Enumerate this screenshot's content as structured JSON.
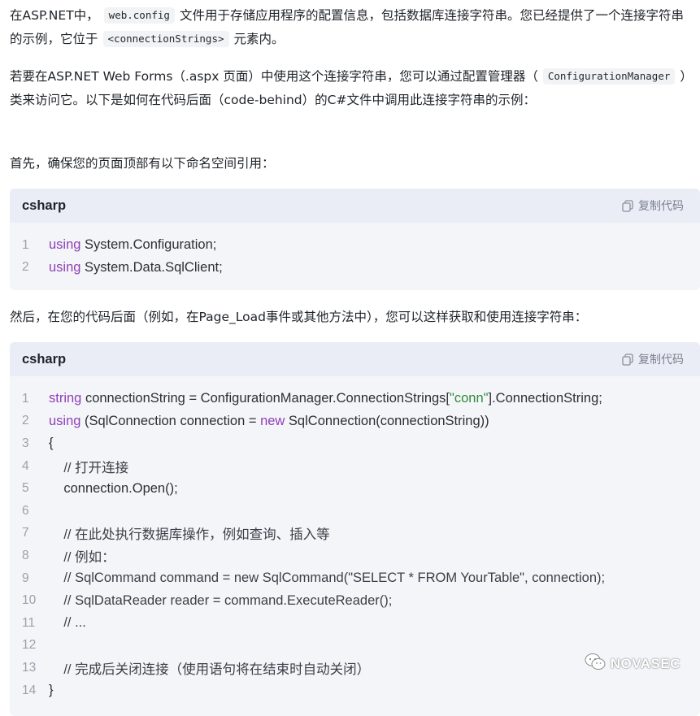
{
  "paragraphs": {
    "p1": {
      "pre": "在ASP.NET中，",
      "code1": "web.config",
      "mid": "文件用于存储应用程序的配置信息，包括数据库连接字符串。您已经提供了一个连接字符串的示例，它位于",
      "code2": "<connectionStrings>",
      "post": "元素内。"
    },
    "p2": {
      "pre": "若要在ASP.NET Web Forms（.aspx 页面）中使用这个连接字符串，您可以通过配置管理器（",
      "code": "ConfigurationManager",
      "post": "）类来访问它。以下是如何在代码后面（code-behind）的C#文件中调用此连接字符串的示例："
    },
    "p3": "首先，确保您的页面顶部有以下命名空间引用：",
    "p4": "然后，在您的代码后面（例如，在Page_Load事件或其他方法中），您可以这样获取和使用连接字符串："
  },
  "code_blocks": [
    {
      "lang": "csharp",
      "copy_label": "复制代码",
      "lines": [
        {
          "n": "1",
          "kw": "using",
          "rest": " System.Configuration;"
        },
        {
          "n": "2",
          "kw": "using",
          "rest": " System.Data.SqlClient;"
        }
      ]
    },
    {
      "lang": "csharp",
      "copy_label": "复制代码",
      "lines": [
        {
          "n": "1",
          "kw": "string",
          "a": " connectionString = ConfigurationManager.ConnectionStrings[",
          "str": "\"conn\"",
          "b": "].ConnectionString;"
        },
        {
          "n": "2",
          "kw": "using",
          "a": " (SqlConnection connection = ",
          "kw2": "new",
          "b": " SqlConnection(connectionString))"
        },
        {
          "n": "3",
          "a": "{"
        },
        {
          "n": "4",
          "a": "    // 打开连接"
        },
        {
          "n": "5",
          "a": "    connection.Open();"
        },
        {
          "n": "6",
          "a": ""
        },
        {
          "n": "7",
          "a": "    // 在此处执行数据库操作，例如查询、插入等"
        },
        {
          "n": "8",
          "a": "    // 例如："
        },
        {
          "n": "9",
          "a": "    // SqlCommand command = new SqlCommand(\"SELECT * FROM YourTable\", connection);"
        },
        {
          "n": "10",
          "a": "    // SqlDataReader reader = command.ExecuteReader();"
        },
        {
          "n": "11",
          "a": "    // ..."
        },
        {
          "n": "12",
          "a": ""
        },
        {
          "n": "13",
          "a": "    // 完成后关闭连接（使用语句将在结束时自动关闭）"
        },
        {
          "n": "14",
          "a": "}"
        }
      ]
    }
  ],
  "watermark": "NOVASEC",
  "icons": {
    "copy": "copy-icon",
    "watermark": "wechat-icon"
  }
}
